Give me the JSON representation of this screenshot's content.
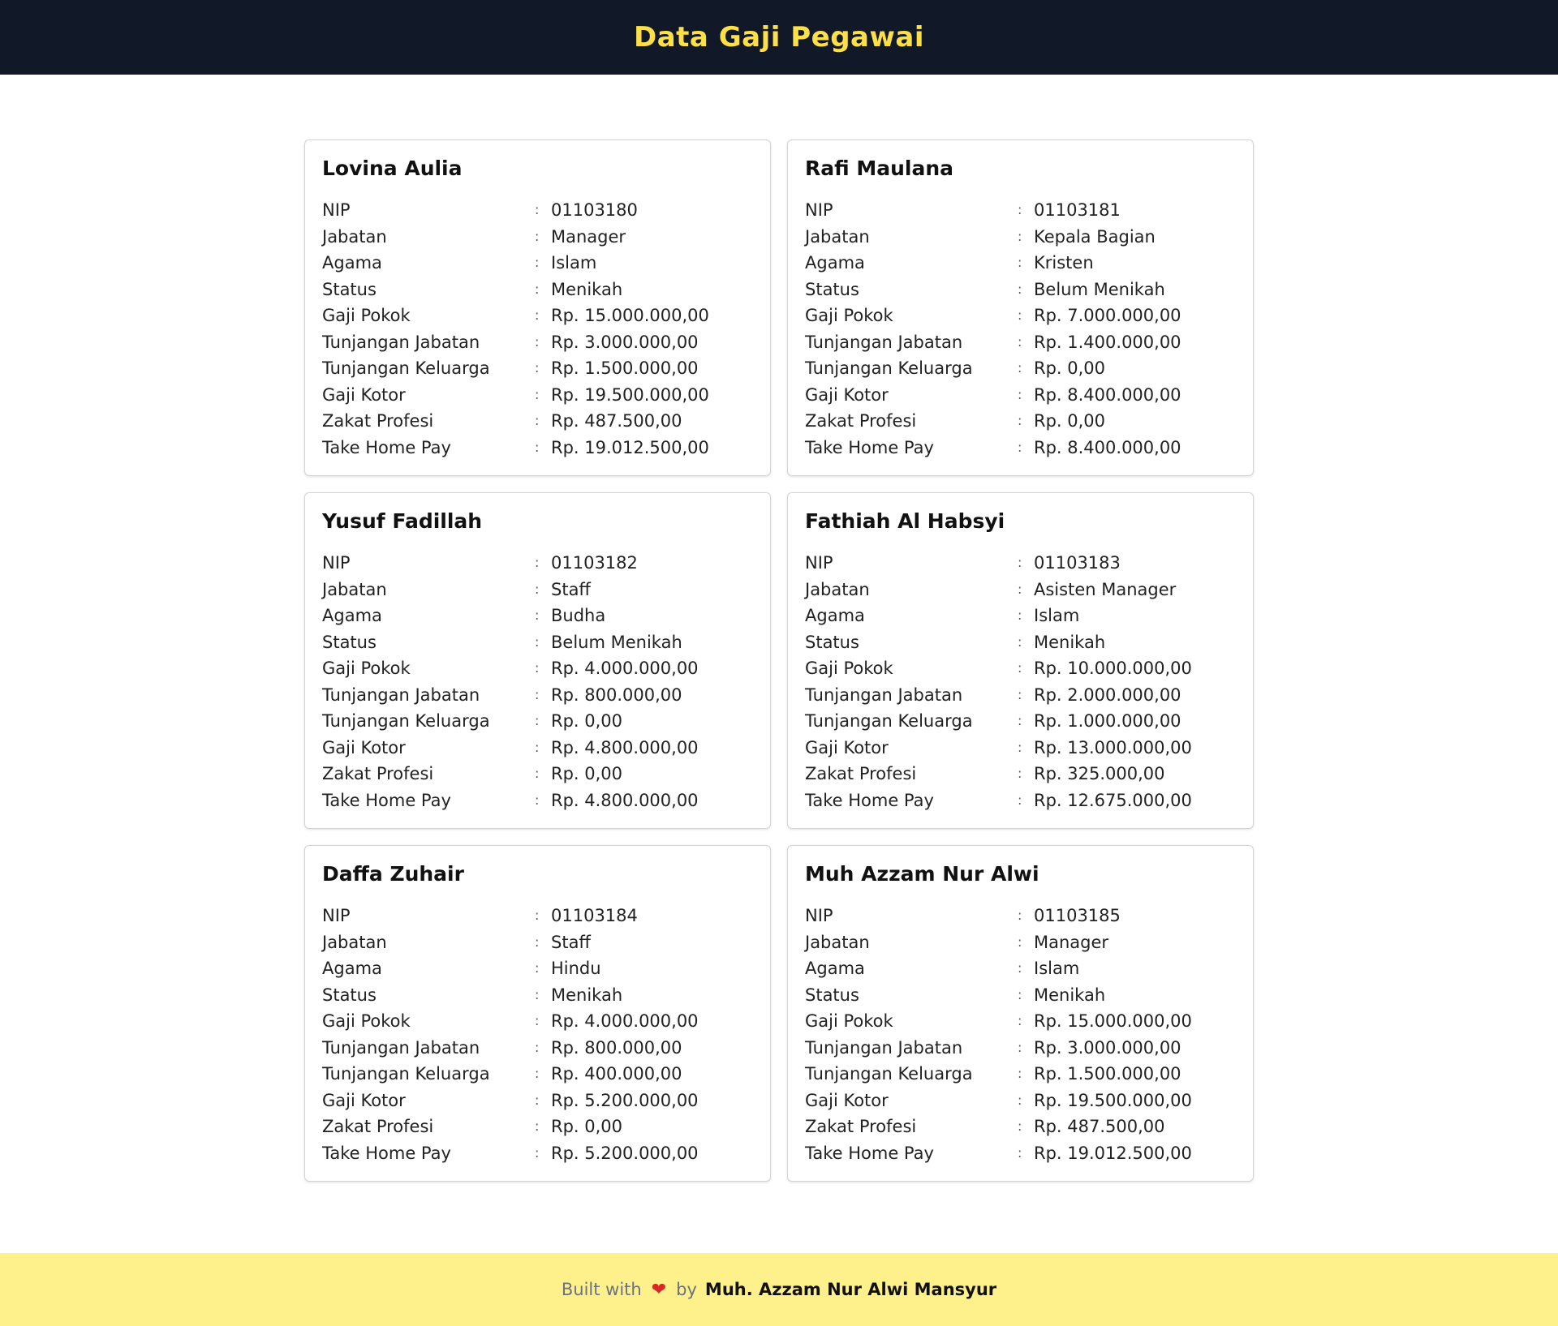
{
  "header": {
    "title": "Data Gaji Pegawai"
  },
  "field_labels": {
    "nip": "NIP",
    "jabatan": "Jabatan",
    "agama": "Agama",
    "status": "Status",
    "gaji_pokok": "Gaji Pokok",
    "tunjangan_jabatan": "Tunjangan Jabatan",
    "tunjangan_keluarga": "Tunjangan Keluarga",
    "gaji_kotor": "Gaji Kotor",
    "zakat_profesi": "Zakat Profesi",
    "take_home_pay": "Take Home Pay"
  },
  "separator": ":",
  "employees": [
    {
      "name": "Lovina Aulia",
      "nip": "01103180",
      "jabatan": "Manager",
      "agama": "Islam",
      "status": "Menikah",
      "gaji_pokok": "Rp. 15.000.000,00",
      "tunjangan_jabatan": "Rp. 3.000.000,00",
      "tunjangan_keluarga": "Rp. 1.500.000,00",
      "gaji_kotor": "Rp. 19.500.000,00",
      "zakat_profesi": "Rp. 487.500,00",
      "take_home_pay": "Rp. 19.012.500,00"
    },
    {
      "name": "Rafi Maulana",
      "nip": "01103181",
      "jabatan": "Kepala Bagian",
      "agama": "Kristen",
      "status": "Belum Menikah",
      "gaji_pokok": "Rp. 7.000.000,00",
      "tunjangan_jabatan": "Rp. 1.400.000,00",
      "tunjangan_keluarga": "Rp. 0,00",
      "gaji_kotor": "Rp. 8.400.000,00",
      "zakat_profesi": "Rp. 0,00",
      "take_home_pay": "Rp. 8.400.000,00"
    },
    {
      "name": "Yusuf Fadillah",
      "nip": "01103182",
      "jabatan": "Staff",
      "agama": "Budha",
      "status": "Belum Menikah",
      "gaji_pokok": "Rp. 4.000.000,00",
      "tunjangan_jabatan": "Rp. 800.000,00",
      "tunjangan_keluarga": "Rp. 0,00",
      "gaji_kotor": "Rp. 4.800.000,00",
      "zakat_profesi": "Rp. 0,00",
      "take_home_pay": "Rp. 4.800.000,00"
    },
    {
      "name": "Fathiah Al Habsyi",
      "nip": "01103183",
      "jabatan": "Asisten Manager",
      "agama": "Islam",
      "status": "Menikah",
      "gaji_pokok": "Rp. 10.000.000,00",
      "tunjangan_jabatan": "Rp. 2.000.000,00",
      "tunjangan_keluarga": "Rp. 1.000.000,00",
      "gaji_kotor": "Rp. 13.000.000,00",
      "zakat_profesi": "Rp. 325.000,00",
      "take_home_pay": "Rp. 12.675.000,00"
    },
    {
      "name": "Daffa Zuhair",
      "nip": "01103184",
      "jabatan": "Staff",
      "agama": "Hindu",
      "status": "Menikah",
      "gaji_pokok": "Rp. 4.000.000,00",
      "tunjangan_jabatan": "Rp. 800.000,00",
      "tunjangan_keluarga": "Rp. 400.000,00",
      "gaji_kotor": "Rp. 5.200.000,00",
      "zakat_profesi": "Rp. 0,00",
      "take_home_pay": "Rp. 5.200.000,00"
    },
    {
      "name": "Muh Azzam Nur Alwi",
      "nip": "01103185",
      "jabatan": "Manager",
      "agama": "Islam",
      "status": "Menikah",
      "gaji_pokok": "Rp. 15.000.000,00",
      "tunjangan_jabatan": "Rp. 3.000.000,00",
      "tunjangan_keluarga": "Rp. 1.500.000,00",
      "gaji_kotor": "Rp. 19.500.000,00",
      "zakat_profesi": "Rp. 487.500,00",
      "take_home_pay": "Rp. 19.012.500,00"
    }
  ],
  "footer": {
    "built_with": "Built with",
    "heart_icon": "heart-icon",
    "by": "by",
    "author": "Muh. Azzam Nur Alwi Mansyur",
    "heart_color": "#dc2626"
  },
  "colors": {
    "header_bg": "#111827",
    "header_text": "#fde047",
    "footer_bg": "#fef08a"
  }
}
